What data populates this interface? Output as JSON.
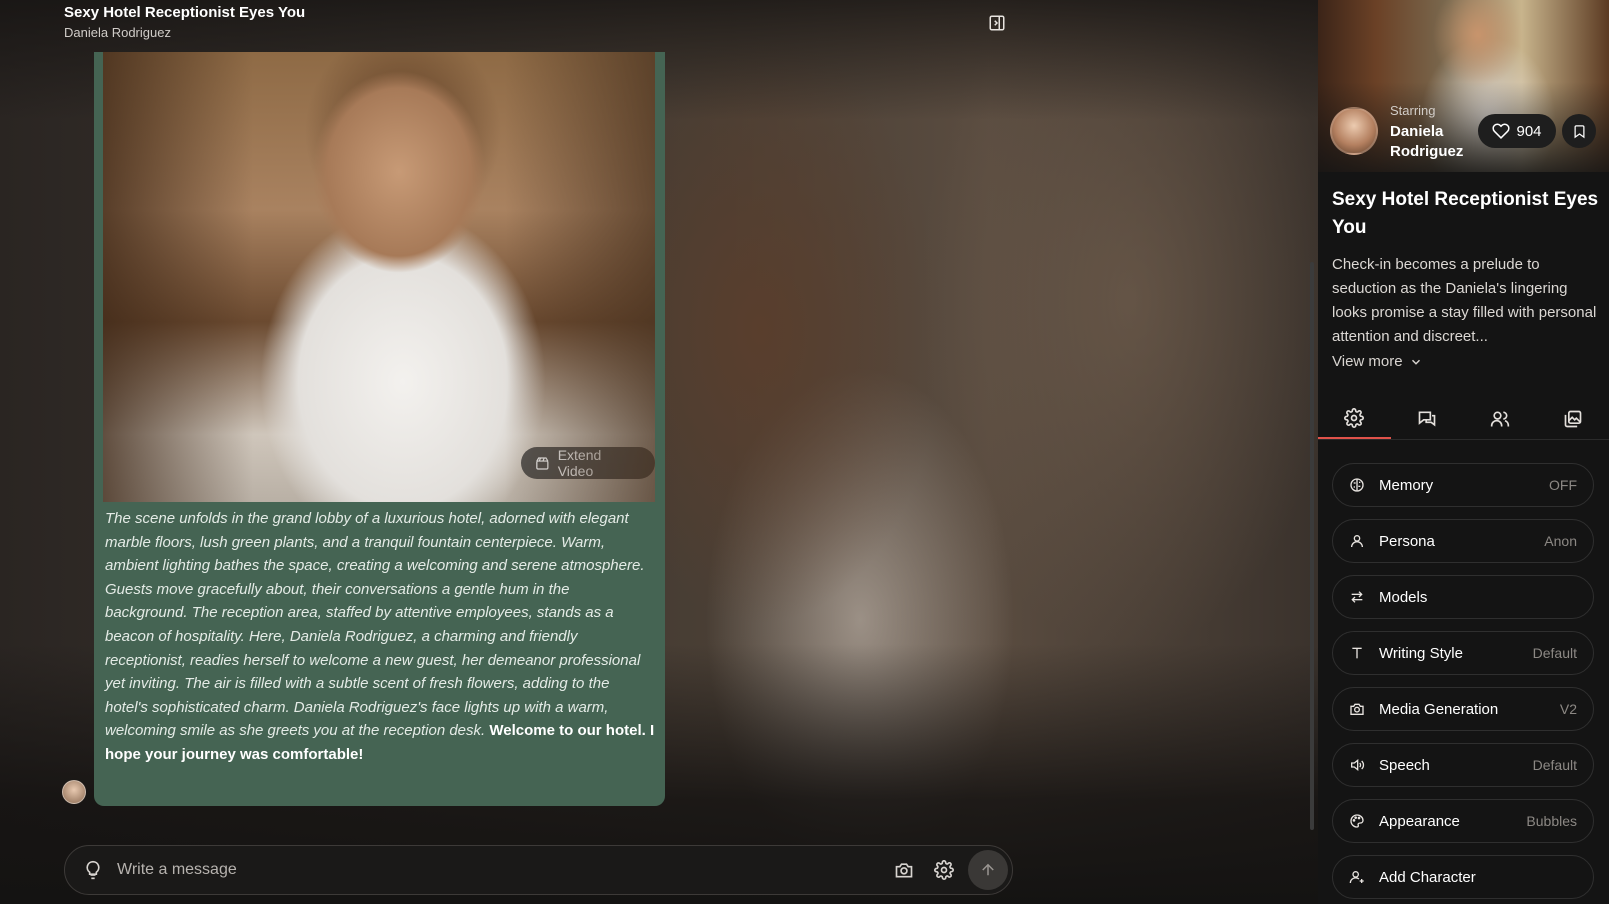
{
  "header": {
    "title": "Sexy Hotel Receptionist Eyes You",
    "subtitle": "Daniela Rodriguez"
  },
  "message": {
    "extend_video_label": "Extend Video",
    "narration": "The scene unfolds in the grand lobby of a luxurious hotel, adorned with elegant marble floors, lush green plants, and a tranquil fountain centerpiece. Warm, ambient lighting bathes the space, creating a welcoming and serene atmosphere. Guests move gracefully about, their conversations a gentle hum in the background. The reception area, staffed by attentive employees, stands as a beacon of hospitality. Here, Daniela Rodriguez, a charming and friendly receptionist, readies herself to welcome a new guest, her demeanor professional yet inviting. The air is filled with a subtle scent of fresh flowers, adding to the hotel's sophisticated charm. Daniela Rodriguez's face lights up with a warm, welcoming smile as she greets you at the reception desk.",
    "dialogue": "Welcome to our hotel. I hope your journey was comfortable!"
  },
  "composer": {
    "placeholder": "Write a message"
  },
  "sidebar": {
    "starring_label": "Starring",
    "star_name": "Daniela Rodriguez",
    "likes": "904",
    "title": "Sexy Hotel Receptionist Eyes You",
    "description": "Check-in becomes a prelude to seduction as the Daniela's lingering looks promise a stay filled with personal attention and discreet...",
    "view_more": "View more",
    "settings": [
      {
        "label": "Memory",
        "value": "OFF",
        "icon": "brain-icon"
      },
      {
        "label": "Persona",
        "value": "Anon",
        "icon": "user-icon"
      },
      {
        "label": "Models",
        "value": "",
        "icon": "swap-arrows-icon"
      },
      {
        "label": "Writing Style",
        "value": "Default",
        "icon": "text-icon"
      },
      {
        "label": "Media Generation",
        "value": "V2",
        "icon": "camera-icon"
      },
      {
        "label": "Speech",
        "value": "Default",
        "icon": "speaker-icon"
      },
      {
        "label": "Appearance",
        "value": "Bubbles",
        "icon": "palette-icon"
      },
      {
        "label": "Add Character",
        "value": "",
        "icon": "add-user-icon"
      }
    ]
  },
  "colors": {
    "bubble": "#456453",
    "active_tab": "#e0524a",
    "sidebar_bg": "#141414"
  }
}
